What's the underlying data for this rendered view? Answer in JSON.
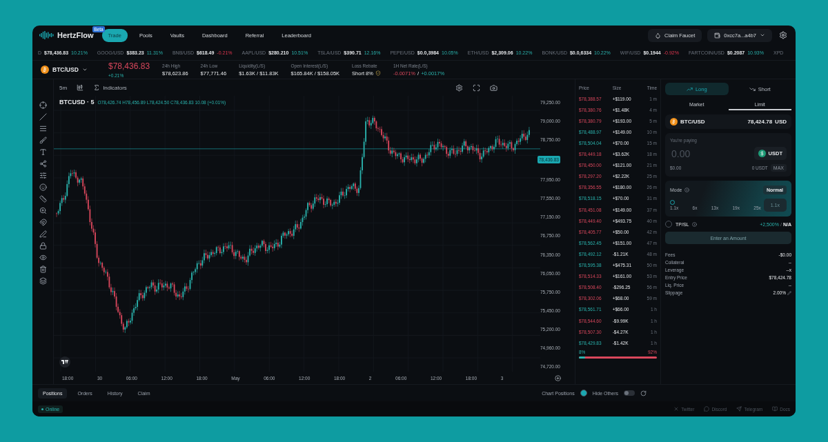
{
  "header": {
    "logo": "HertzFlow",
    "badge": "Beta",
    "nav": [
      {
        "label": "Trade",
        "selected": true
      },
      {
        "label": "Pools",
        "selected": false
      },
      {
        "label": "Vaults",
        "selected": false
      },
      {
        "label": "Dashboard",
        "selected": false
      },
      {
        "label": "Referral",
        "selected": false
      },
      {
        "label": "Leaderboard",
        "selected": false
      }
    ],
    "claim_button": "Claim Faucet",
    "wallet": "0xcc7a...a4b7"
  },
  "ticker": [
    {
      "symbol": "D",
      "price": "$78,436.83",
      "change": "10.21%",
      "up": true
    },
    {
      "symbol": "GOOG/USD",
      "price": "$383.23",
      "change": "11.31%",
      "up": true
    },
    {
      "symbol": "BNB/USD",
      "price": "$618.49",
      "change": "-0.21%",
      "up": false
    },
    {
      "symbol": "AAPL/USD",
      "price": "$280.210",
      "change": "10.51%",
      "up": true
    },
    {
      "symbol": "TSLA/USD",
      "price": "$390.71",
      "change": "12.16%",
      "up": true
    },
    {
      "symbol": "PEPE/USD",
      "price": "$0.0,3984",
      "change": "10.05%",
      "up": true
    },
    {
      "symbol": "ETH/USD",
      "price": "$2,309.06",
      "change": "10.22%",
      "up": true
    },
    {
      "symbol": "BONK/USD",
      "price": "$0.0,6334",
      "change": "10.22%",
      "up": true
    },
    {
      "symbol": "WIF/USD",
      "price": "$0.1944",
      "change": "-0.92%",
      "up": false
    },
    {
      "symbol": "FARTCOIN/USD",
      "price": "$0.2087",
      "change": "10.93%",
      "up": true
    },
    {
      "symbol": "XPD"
    }
  ],
  "market": {
    "pair": "BTC/USD",
    "price": "$78,436.83",
    "change": "+0.21%",
    "stats": [
      {
        "label": "24h High",
        "kind": "plain",
        "values": [
          {
            "text": "$78,623.86",
            "kind": "neutral"
          }
        ]
      },
      {
        "label": "24h Low",
        "kind": "plain",
        "values": [
          {
            "text": "$77,771.46",
            "kind": "neutral"
          }
        ]
      },
      {
        "label": "Liquidity(L/S)",
        "kind": "plain",
        "values": [
          {
            "text": "$1.63K / $11.83K",
            "kind": "neutral"
          }
        ]
      },
      {
        "label": "Open Interest(L/S)",
        "kind": "plain",
        "values": [
          {
            "text": "$165.84K / $158.05K",
            "kind": "neutral"
          }
        ]
      },
      {
        "label": "Loss Rebate",
        "kind": "rebate",
        "values": [
          {
            "text": "Short 8%",
            "kind": "neutral"
          }
        ]
      },
      {
        "label": "1H Net Rate(L/S)",
        "kind": "plain",
        "values": [
          {
            "text": "-0.0071%",
            "kind": "down"
          },
          {
            "text": "/",
            "kind": "neutral"
          },
          {
            "text": "+0.0017%",
            "kind": "up"
          }
        ]
      }
    ]
  },
  "chart": {
    "interval": "5m",
    "indicators": "Indicators",
    "symbol": "BTCUSD · 5",
    "ohlc": "O78,426.74 H78,456.89 L78,424.50 C78,436.83 10.08 (+0.01%)",
    "price_axis": [
      "79,250.00",
      "79,000.00",
      "78,750.00",
      "77,950.00",
      "77,550.00",
      "77,150.00",
      "76,750.00",
      "76,350.00",
      "76,050.00",
      "75,750.00",
      "75,450.00",
      "75,200.00",
      "74,960.00",
      "74,720.00"
    ],
    "current_price": "78,436.83",
    "time_axis": [
      "18:00",
      "30",
      "06:00",
      "12:00",
      "18:00",
      "May",
      "06:00",
      "12:00",
      "18:00",
      "2",
      "06:00",
      "12:00",
      "18:00",
      "3"
    ]
  },
  "order_book": {
    "columns": [
      "Price",
      "Size",
      "Time"
    ],
    "rows": [
      {
        "price": "$78,388.57",
        "size": "+$119.00",
        "time": "1 m",
        "kind": "sell"
      },
      {
        "price": "$78,380.76",
        "size": "+$1.48K",
        "time": "4 m",
        "kind": "sell"
      },
      {
        "price": "$78,380.79",
        "size": "+$193.00",
        "time": "5 m",
        "kind": "sell"
      },
      {
        "price": "$78,488.97",
        "size": "+$149.00",
        "time": "10 m",
        "kind": "buy"
      },
      {
        "price": "$78,504.04",
        "size": "+$70.00",
        "time": "15 m",
        "kind": "buy"
      },
      {
        "price": "$78,449.18",
        "size": "+$3.62K",
        "time": "18 m",
        "kind": "sell"
      },
      {
        "price": "$78,450.00",
        "size": "+$121.00",
        "time": "21 m",
        "kind": "sell"
      },
      {
        "price": "$78,297.20",
        "size": "+$2.22K",
        "time": "25 m",
        "kind": "sell"
      },
      {
        "price": "$78,356.55",
        "size": "+$180.00",
        "time": "26 m",
        "kind": "sell"
      },
      {
        "price": "$78,518.15",
        "size": "+$70.00",
        "time": "31 m",
        "kind": "buy"
      },
      {
        "price": "$78,451.08",
        "size": "+$149.00",
        "time": "37 m",
        "kind": "sell"
      },
      {
        "price": "$78,449.40",
        "size": "+$493.75",
        "time": "40 m",
        "kind": "sell"
      },
      {
        "price": "$78,405.77",
        "size": "+$50.00",
        "time": "42 m",
        "kind": "sell"
      },
      {
        "price": "$78,562.45",
        "size": "+$151.00",
        "time": "47 m",
        "kind": "buy"
      },
      {
        "price": "$78,492.12",
        "size": "-$1.21K",
        "time": "48 m",
        "kind": "buy"
      },
      {
        "price": "$78,595.38",
        "size": "+$475.31",
        "time": "50 m",
        "kind": "buy"
      },
      {
        "price": "$78,514.33",
        "size": "+$161.00",
        "time": "53 m",
        "kind": "sell"
      },
      {
        "price": "$78,508.40",
        "size": "-$296.25",
        "time": "56 m",
        "kind": "sell"
      },
      {
        "price": "$78,302.06",
        "size": "+$68.00",
        "time": "59 m",
        "kind": "sell"
      },
      {
        "price": "$78,561.71",
        "size": "+$66.00",
        "time": "1 h",
        "kind": "buy"
      },
      {
        "price": "$78,544.60",
        "size": "-$9.99K",
        "time": "1 h",
        "kind": "sell"
      },
      {
        "price": "$78,507.30",
        "size": "-$4.27K",
        "time": "1 h",
        "kind": "sell"
      },
      {
        "price": "$78,429.83",
        "size": "-$1.42K",
        "time": "1 h",
        "kind": "buy"
      }
    ],
    "buy_share": "8%",
    "sell_share": "92%",
    "level": 0.08
  },
  "order_panel": {
    "sides": [
      {
        "label": "Long",
        "selected": true
      },
      {
        "label": "Short",
        "selected": false
      }
    ],
    "order_types": [
      {
        "label": "Market",
        "selected": false
      },
      {
        "label": "Limit",
        "selected": true
      }
    ],
    "pair": "BTC/USD",
    "pair_price": "78,424.78",
    "pair_currency": "USD",
    "paying": {
      "label": "You're paying",
      "placeholder": "0.00",
      "token": "USDT",
      "value": "$0.00",
      "balance": "0 USDT",
      "max": "MAX"
    },
    "mode": {
      "label": "Mode",
      "value": "Normal",
      "level": 0,
      "marks": [
        "1.1x",
        "6x",
        "13x",
        "19x",
        "25x"
      ],
      "leverage": "1.1x"
    },
    "tpsl": {
      "label": "TP/SL",
      "checked": false,
      "gain": "+2,500%",
      "separator": "/",
      "loss": "N/A"
    },
    "submit": {
      "label": "Enter an Amount",
      "disabled": true
    },
    "details": [
      {
        "label": "Fees",
        "value": "-$0.00"
      },
      {
        "label": "Collateral",
        "value": "--"
      },
      {
        "label": "Leverage",
        "value": "--x"
      },
      {
        "label": "Entry Price",
        "value": "$78,424.78"
      },
      {
        "label": "Liq. Price",
        "value": "--"
      },
      {
        "label": "Slippage",
        "value": "2.00%"
      }
    ]
  },
  "bottom": {
    "tabs": [
      {
        "label": "Positions",
        "selected": true
      },
      {
        "label": "Orders",
        "selected": false
      },
      {
        "label": "History",
        "selected": false
      },
      {
        "label": "Claim",
        "selected": false
      }
    ],
    "chart_positions": {
      "label": "Chart Positions",
      "checked": true
    },
    "hide_others": {
      "label": "Hide Others",
      "on": false
    }
  },
  "status": {
    "label": "Online",
    "links": [
      {
        "label": "Twitter",
        "kind": "x"
      },
      {
        "label": "Discord",
        "kind": "discord"
      },
      {
        "label": "Telegram",
        "kind": "telegram"
      },
      {
        "label": "Docs",
        "kind": "docs"
      }
    ]
  }
}
